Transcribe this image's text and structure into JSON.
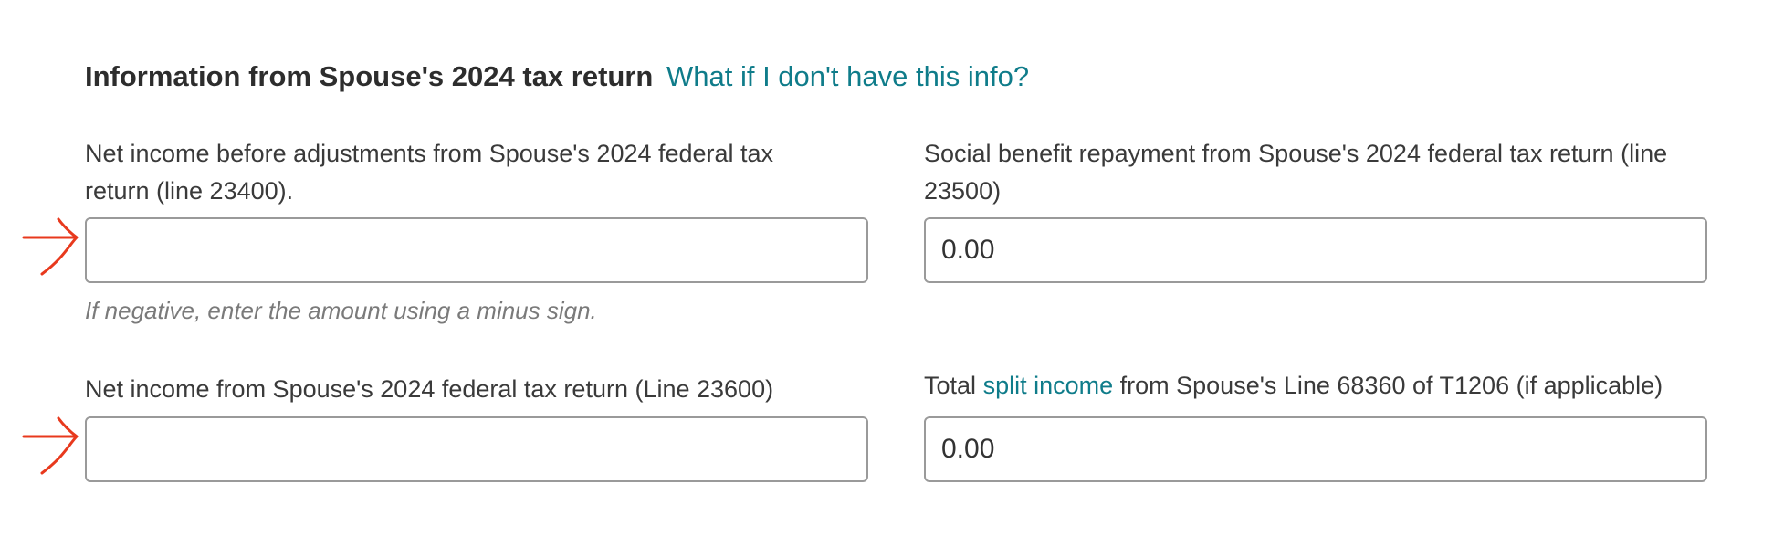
{
  "section": {
    "title": "Information from Spouse's 2024 tax return",
    "help_link": "What if I don't have this info?"
  },
  "fields": {
    "net_income_before_adjustments": {
      "label": "Net income before adjustments from Spouse's 2024 federal tax return (line 23400).",
      "value": "",
      "hint": "If negative, enter the amount using a minus sign."
    },
    "social_benefit_repayment": {
      "label": "Social benefit repayment from Spouse's 2024 federal tax return (line 23500)",
      "value": "0.00"
    },
    "net_income": {
      "label": "Net income from Spouse's 2024 federal tax return (Line 23600)",
      "value": ""
    },
    "total_split_income": {
      "label_prefix": "Total",
      "label_link": "split income",
      "label_suffix": "from Spouse's Line 68360 of T1206 (if applicable)",
      "value": "0.00"
    }
  },
  "annotations": {
    "arrow_color": "#e8391d",
    "icon": "red-arrow-icon"
  },
  "colors": {
    "link": "#0f7c8a",
    "heading": "#2d2d2d",
    "hint": "#7a7a7a",
    "input_border": "#9a9a9a"
  }
}
